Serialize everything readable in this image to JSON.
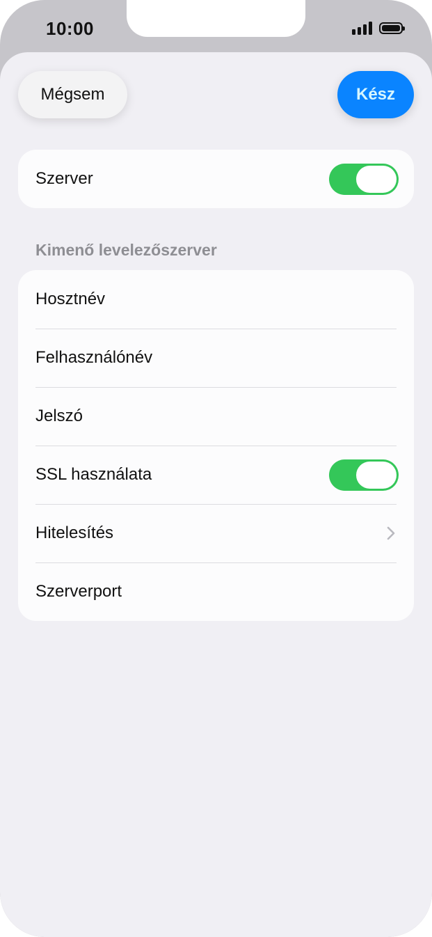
{
  "status_bar": {
    "time": "10:00"
  },
  "nav": {
    "cancel_label": "Mégsem",
    "done_label": "Kész"
  },
  "server_card": {
    "label": "Szerver",
    "enabled": true
  },
  "outgoing": {
    "header": "Kimenő levelezőszerver",
    "rows": [
      {
        "label": "Hosztnév"
      },
      {
        "label": "Felhasználónév"
      },
      {
        "label": "Jelszó"
      },
      {
        "label": "SSL használata",
        "toggle": true
      },
      {
        "label": "Hitelesítés",
        "chevron": "chevron-right-icon"
      },
      {
        "label": "Szerverport"
      }
    ]
  },
  "colors": {
    "accent": "#0a84ff",
    "toggle_on": "#34c759",
    "background": "#f0eff4"
  }
}
